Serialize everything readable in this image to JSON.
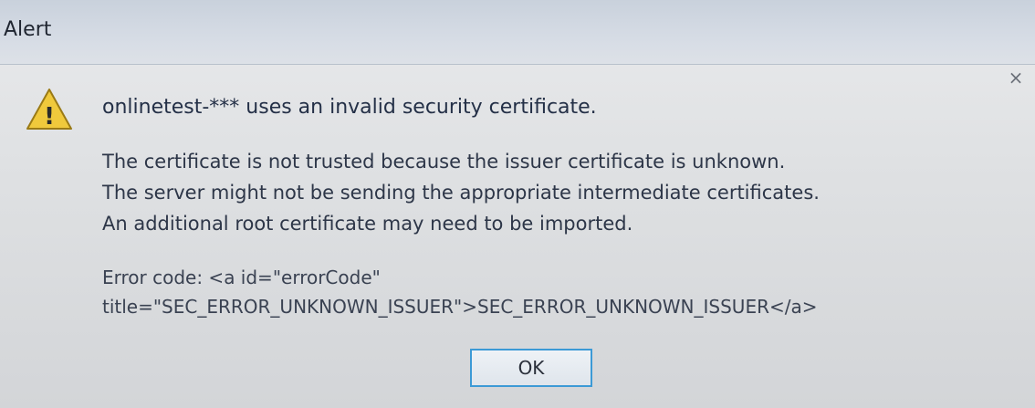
{
  "window": {
    "title": "Alert",
    "close_glyph": "×"
  },
  "icon": {
    "name": "warning-icon",
    "glyph": "!",
    "color": "#e8c33a"
  },
  "message": {
    "heading": "onlinetest-*** uses an invalid security certificate.",
    "lines": [
      "The certificate is not trusted because the issuer certificate is unknown.",
      "The server might not be sending the appropriate intermediate certificates.",
      "An additional root certificate may need to be imported."
    ]
  },
  "error": {
    "line1": "Error code: <a id=\"errorCode\"",
    "line2": "title=\"SEC_ERROR_UNKNOWN_ISSUER\">SEC_ERROR_UNKNOWN_ISSUER</a>"
  },
  "buttons": {
    "ok_label": "OK"
  },
  "colors": {
    "focus_border": "#3c9ad6"
  }
}
